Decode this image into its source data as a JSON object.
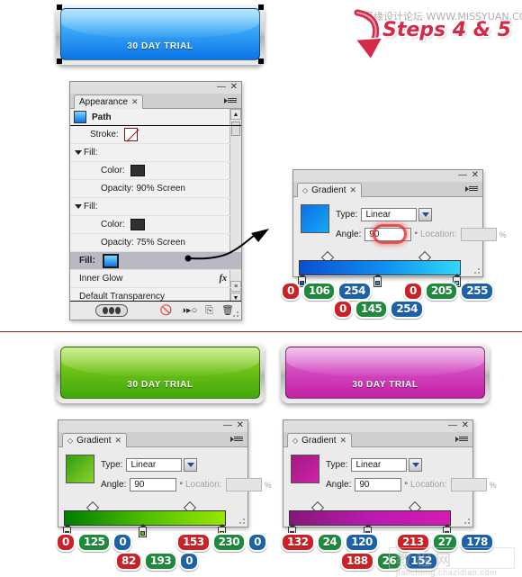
{
  "page": {
    "divider_color": "#8b2121",
    "background": "#ffffff"
  },
  "annotations": {
    "steps_heading": "Steps 4 & 5",
    "watermark_top": "思缘设计论坛 WWW.MISSYUAN.COM",
    "watermark_bottom_cn": "教程网",
    "watermark_bottom_en": "jiaocheng.chazidian.com",
    "arrow_label": "fill-to-gradient-arrow",
    "down_arrow_label": "curved-down-arrow"
  },
  "buttons": {
    "blue": {
      "label": "30 DAY TRIAL",
      "top_color": "#7ed2fa",
      "bottom_color": "#0b74e8",
      "selected": true
    },
    "green": {
      "label": "30 DAY TRIAL",
      "top_color": "#9ddc2b",
      "bottom_color": "#3fa80a",
      "selected": false
    },
    "pink": {
      "label": "30 DAY TRIAL",
      "top_color": "#e07ad6",
      "bottom_color": "#c221a6",
      "selected": false
    }
  },
  "appearance_panel": {
    "tab_label": "Appearance",
    "tab_close": "✕",
    "window_minimize": "—",
    "window_close": "✕",
    "target_label": "Path",
    "rows": [
      {
        "label": "Stroke:",
        "kind": "stroke",
        "value": ""
      },
      {
        "label": "Fill:",
        "kind": "group",
        "value": ""
      },
      {
        "label": "Color:",
        "kind": "color",
        "value": ""
      },
      {
        "label": "Opacity:",
        "kind": "text",
        "value": "Opacity: 90% Screen"
      },
      {
        "label": "Fill:",
        "kind": "group",
        "value": ""
      },
      {
        "label": "Color:",
        "kind": "color",
        "value": ""
      },
      {
        "label": "Opacity:",
        "kind": "text",
        "value": "Opacity: 75% Screen"
      },
      {
        "label": "Fill:",
        "kind": "fill-selected",
        "value": ""
      },
      {
        "label": "Inner Glow",
        "kind": "effect",
        "value": "fx"
      },
      {
        "label": "Default Transparency",
        "kind": "text",
        "value": ""
      }
    ],
    "footer_icons": [
      "toggle-visibility-pill",
      "clear-appearance-icon",
      "reduce-to-basic-appearance-icon",
      "duplicate-item-icon",
      "delete-item-icon"
    ]
  },
  "gradient_panels": [
    {
      "id": "blue",
      "tab_label": "Gradient",
      "tab_close": "✕",
      "window_minimize": "—",
      "window_close": "✕",
      "type_label": "Type:",
      "type_value": "Linear",
      "angle_label": "Angle:",
      "angle_value": "90",
      "degree_symbol": "°",
      "location_label": "Location:",
      "location_value": "",
      "percent_symbol": "%",
      "angle_highlighted": true,
      "swatch_from": "#0c6fe6",
      "swatch_to": "#18a8f4",
      "strip_stops": [
        "#0b4fd0",
        "#0e8ef0",
        "#2fd8fb"
      ],
      "rgb_left": {
        "r": "0",
        "g": "106",
        "b": "254"
      },
      "rgb_right": {
        "r": "0",
        "g": "205",
        "b": "255"
      },
      "rgb_mid": {
        "r": "0",
        "g": "145",
        "b": "254"
      }
    },
    {
      "id": "green",
      "tab_label": "Gradient",
      "tab_close": "✕",
      "window_minimize": "—",
      "window_close": "✕",
      "type_label": "Type:",
      "type_value": "Linear",
      "angle_label": "Angle:",
      "angle_value": "90",
      "degree_symbol": "°",
      "location_label": "Location:",
      "location_value": "",
      "percent_symbol": "%",
      "angle_highlighted": false,
      "swatch_from": "#2f9e10",
      "swatch_to": "#8ed22a",
      "strip_stops": [
        "#007d00",
        "#52c100",
        "#99e600"
      ],
      "rgb_left": {
        "r": "0",
        "g": "125",
        "b": "0"
      },
      "rgb_right": {
        "r": "153",
        "g": "230",
        "b": "0"
      },
      "rgb_mid": {
        "r": "82",
        "g": "193",
        "b": "0"
      }
    },
    {
      "id": "pink",
      "tab_label": "Gradient",
      "tab_close": "✕",
      "window_minimize": "—",
      "window_close": "✕",
      "type_label": "Type:",
      "type_value": "Linear",
      "angle_label": "Angle:",
      "angle_value": "90",
      "degree_symbol": "°",
      "location_label": "Location:",
      "location_value": "",
      "percent_symbol": "%",
      "angle_highlighted": false,
      "swatch_from": "#a2197f",
      "swatch_to": "#cf22ab",
      "strip_stops": [
        "#841878",
        "#bc1ab2",
        "#d51bb2"
      ],
      "rgb_left": {
        "r": "132",
        "g": "24",
        "b": "120"
      },
      "rgb_right": {
        "r": "213",
        "g": "27",
        "b": "178"
      },
      "rgb_mid": {
        "r": "188",
        "g": "26",
        "b": "152"
      }
    }
  ]
}
